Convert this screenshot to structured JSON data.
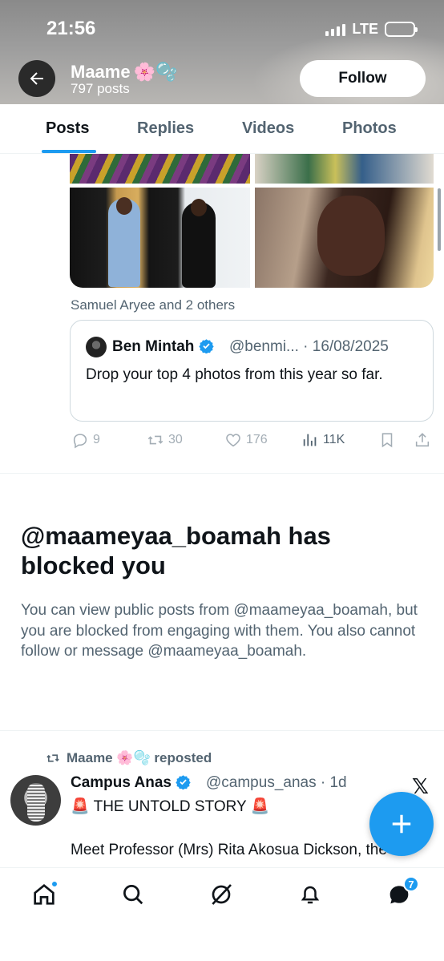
{
  "status_bar": {
    "time": "21:56",
    "network": "LTE"
  },
  "profile": {
    "name": "Maame",
    "name_emoji": "🌸🫧",
    "post_count": "797 posts",
    "follow_label": "Follow"
  },
  "tabs": [
    {
      "label": "Posts",
      "active": true
    },
    {
      "label": "Replies",
      "active": false
    },
    {
      "label": "Videos",
      "active": false
    },
    {
      "label": "Photos",
      "active": false
    }
  ],
  "post": {
    "tagged_text": "Samuel Aryee and 2 others",
    "quote": {
      "author": "Ben Mintah",
      "handle_date": "@benmi... · 16/08/2025",
      "text": "Drop your top 4 photos from this year so far."
    },
    "stats": {
      "replies": "9",
      "reposts": "30",
      "likes": "176",
      "views": "11K"
    }
  },
  "blocked": {
    "title": "@maameyaa_boamah has blocked you",
    "body": "You can view public posts from @maameyaa_boamah, but you are blocked from engaging with them. You also cannot follow or message @maameyaa_boamah."
  },
  "repost": {
    "reposted_by": "Maame 🌸🫧 reposted",
    "author": "Campus Anas",
    "handle_time": "@campus_anas · 1d",
    "line1": "🚨 THE UNTOLD STORY 🚨",
    "line2": "Meet Professor (Mrs) Rita Akosua Dickson, the"
  },
  "nav": {
    "messages_badge": "7"
  },
  "colors": {
    "accent": "#1d9bf0",
    "text": "#0f1419",
    "muted": "#536471",
    "border": "#cfd9de"
  }
}
